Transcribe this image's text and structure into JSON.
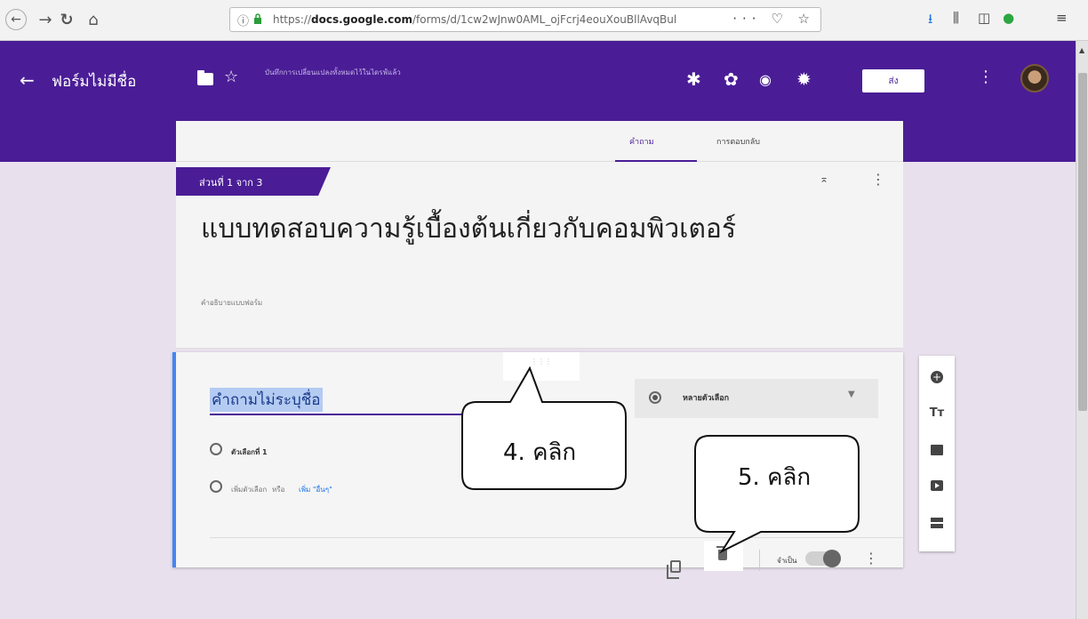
{
  "browser": {
    "back_icon": "back-arrow-icon",
    "forward_icon": "forward-arrow-icon",
    "url_domain": "docs.google.com",
    "url_prefix": "https://",
    "url_path": "/forms/d/1cw2wJnw0AML_ojFcrj4eouXouBllAvqBul",
    "url_actions": "··· ♡ ☆"
  },
  "header": {
    "title": "ฟอร์มไม่มีชื่อ",
    "saved_status": "บันทึกการเปลี่ยนแปลงทั้งหมดไว้ในไดรฟ์แล้ว",
    "send_label": "ส่ง"
  },
  "tabs": [
    "คำถาม",
    "การตอบกลับ"
  ],
  "section": {
    "label": "ส่วนที่ 1 จาก 3",
    "form_title": "แบบทดสอบความรู้เบื้องต้นเกี่ยวกับคอมพิวเตอร์",
    "form_description": "คำอธิบายแบบฟอร์ม"
  },
  "question": {
    "title": "คำถามไม่ระบุชื่อ",
    "type": "หลายตัวเลือก",
    "options": [
      "ตัวเลือกที่ 1"
    ],
    "add_option": "เพิ่มตัวเลือก",
    "or": "หรือ",
    "add_other": "เพิ่ม \"อื่นๆ\"",
    "required_label": "จำเป็น",
    "required": false
  },
  "annotations": {
    "step4": "4. คลิก",
    "step5": "5. คลิก"
  },
  "colors": {
    "brand_purple": "#4a1d96",
    "accent_blue": "#4285f4",
    "background": "#e8e1ed"
  }
}
